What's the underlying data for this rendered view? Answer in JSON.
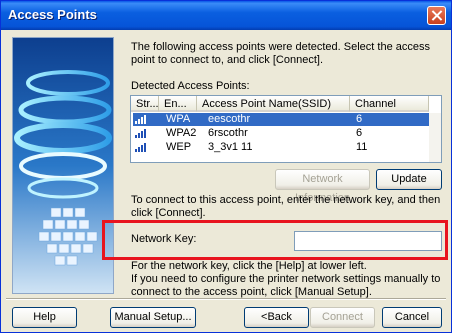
{
  "window": {
    "title": "Access Points"
  },
  "intro_text": "The following access points were detected. Select the access point to connect to, and click [Connect].",
  "list": {
    "label": "Detected Access Points:",
    "columns": [
      "Str...",
      "En...",
      "Access Point Name(SSID)",
      "Channel"
    ],
    "rows": [
      {
        "encryption": "WPA",
        "ssid": "eescothr",
        "channel": "6",
        "selected": true
      },
      {
        "encryption": "WPA2",
        "ssid": "6rscothr",
        "channel": "6",
        "selected": false
      },
      {
        "encryption": "WEP",
        "ssid": "3_3v1 11",
        "channel": "11",
        "selected": false
      }
    ],
    "signal_icon": "signal-strength-icon"
  },
  "buttons": {
    "network_information": "Network Information",
    "update": "Update",
    "help": "Help",
    "manual_setup": "Manual Setup...",
    "back": "<Back",
    "connect": "Connect",
    "cancel": "Cancel"
  },
  "connect_info": "To connect to this access point, enter the network key, and then click [Connect].",
  "network_key": {
    "label": "Network Key:",
    "value": ""
  },
  "help_info": "For the network key, click the [Help] at lower left.\nIf you need to configure the printer network settings manually to connect to the access point, click [Manual Setup].",
  "colors": {
    "highlight": "#e8141e",
    "selection": "#316ac5",
    "titlebar": "#0a5fe0"
  }
}
